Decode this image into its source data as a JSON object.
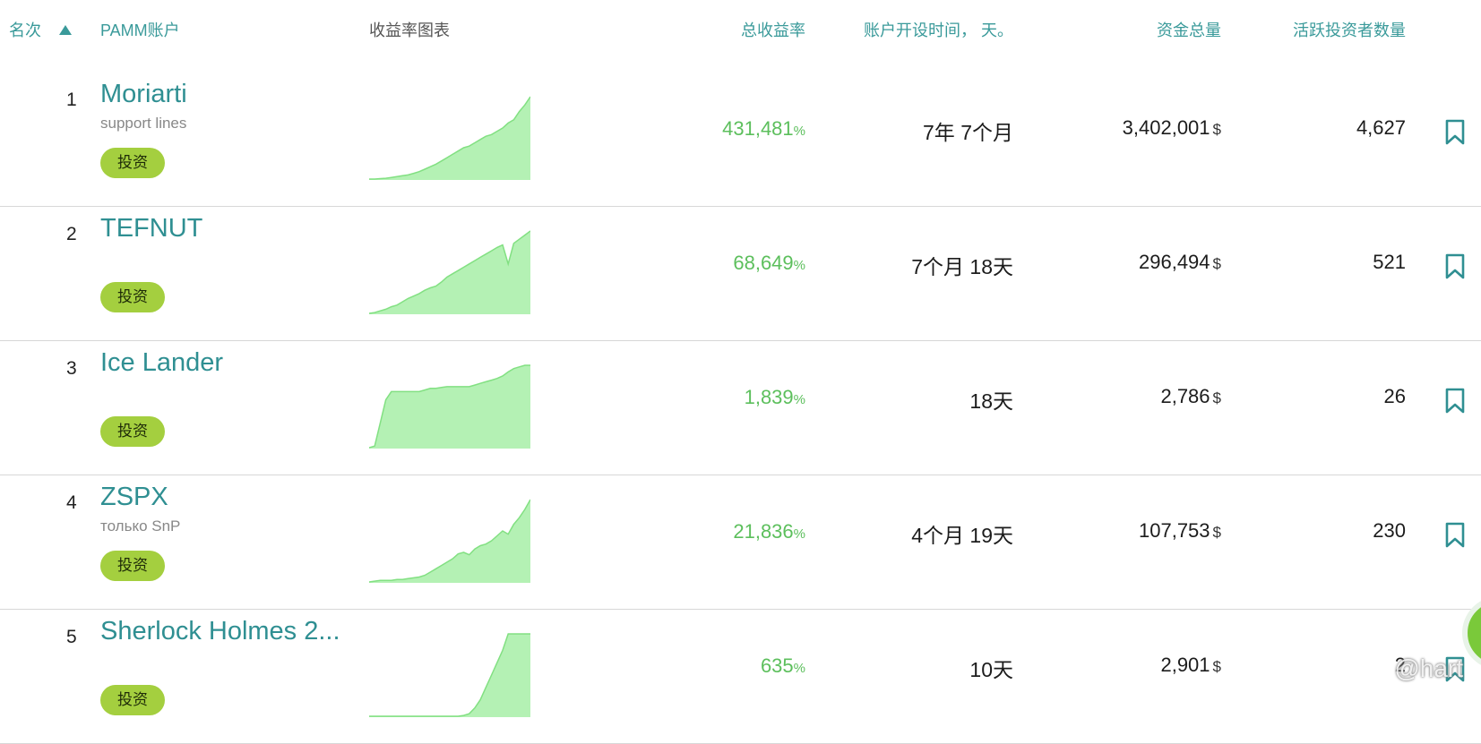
{
  "header": {
    "rank": "名次",
    "account": "PAMM账户",
    "chart": "收益率图表",
    "return": "总收益率",
    "age": "账户开设时间， 天。",
    "funds": "资金总量",
    "investors": "活跃投资者数量"
  },
  "rows": [
    {
      "rank": "1",
      "name": "Moriarti",
      "sub": "support lines",
      "invest": "投资",
      "return": "431,481",
      "unit": "%",
      "age": "7年 7个月",
      "funds": "3,402,001",
      "currency": "$",
      "investors": "4,627",
      "chart": [
        0,
        0,
        0.5,
        1,
        2,
        3,
        4,
        5,
        7,
        9,
        12,
        15,
        18,
        22,
        26,
        30,
        34,
        38,
        40,
        44,
        48,
        52,
        54,
        58,
        62,
        68,
        72,
        82,
        90,
        100
      ]
    },
    {
      "rank": "2",
      "name": "TEFNUT",
      "sub": "",
      "invest": "投资",
      "return": "68,649",
      "unit": "%",
      "age": "7个月 18天",
      "funds": "296,494",
      "currency": "$",
      "investors": "521",
      "chart": [
        0,
        1,
        3,
        5,
        8,
        10,
        14,
        18,
        21,
        24,
        28,
        31,
        33,
        38,
        44,
        48,
        52,
        56,
        60,
        64,
        68,
        72,
        76,
        80,
        83,
        60,
        85,
        90,
        95,
        100
      ]
    },
    {
      "rank": "3",
      "name": "Ice Lander",
      "sub": "",
      "invest": "投资",
      "return": "1,839",
      "unit": "%",
      "age": "18天",
      "funds": "2,786",
      "currency": "$",
      "investors": "26",
      "chart": [
        0,
        2,
        30,
        58,
        68,
        68,
        68,
        68,
        68,
        68,
        70,
        72,
        72,
        73,
        74,
        74,
        74,
        74,
        74,
        76,
        78,
        80,
        82,
        84,
        87,
        92,
        96,
        98,
        100,
        100
      ]
    },
    {
      "rank": "4",
      "name": "ZSPX",
      "sub": "только SnP",
      "invest": "投资",
      "return": "21,836",
      "unit": "%",
      "age": "4个月 19天",
      "funds": "107,753",
      "currency": "$",
      "investors": "230",
      "chart": [
        0,
        1,
        2,
        2,
        2,
        3,
        3,
        4,
        5,
        6,
        8,
        12,
        16,
        20,
        24,
        28,
        34,
        36,
        33,
        40,
        44,
        46,
        50,
        56,
        62,
        58,
        70,
        78,
        88,
        100
      ]
    },
    {
      "rank": "5",
      "name": "Sherlock Holmes 2...",
      "sub": "",
      "invest": "投资",
      "return": "635",
      "unit": "%",
      "age": "10天",
      "funds": "2,901",
      "currency": "$",
      "investors": "2",
      "chart": [
        0,
        0,
        0,
        0,
        0,
        0,
        0,
        0,
        0,
        0,
        0,
        0,
        0,
        0,
        0,
        0,
        0,
        1,
        3,
        10,
        20,
        35,
        50,
        65,
        80,
        100,
        100,
        100,
        100,
        100
      ]
    }
  ],
  "watermark": "@hart",
  "colors": {
    "accent": "#3a9a9a",
    "return": "#5cbf5c",
    "invest_button": "#a4cf3f",
    "chart_fill": "#b4f1b4",
    "chart_line": "#82e082"
  }
}
